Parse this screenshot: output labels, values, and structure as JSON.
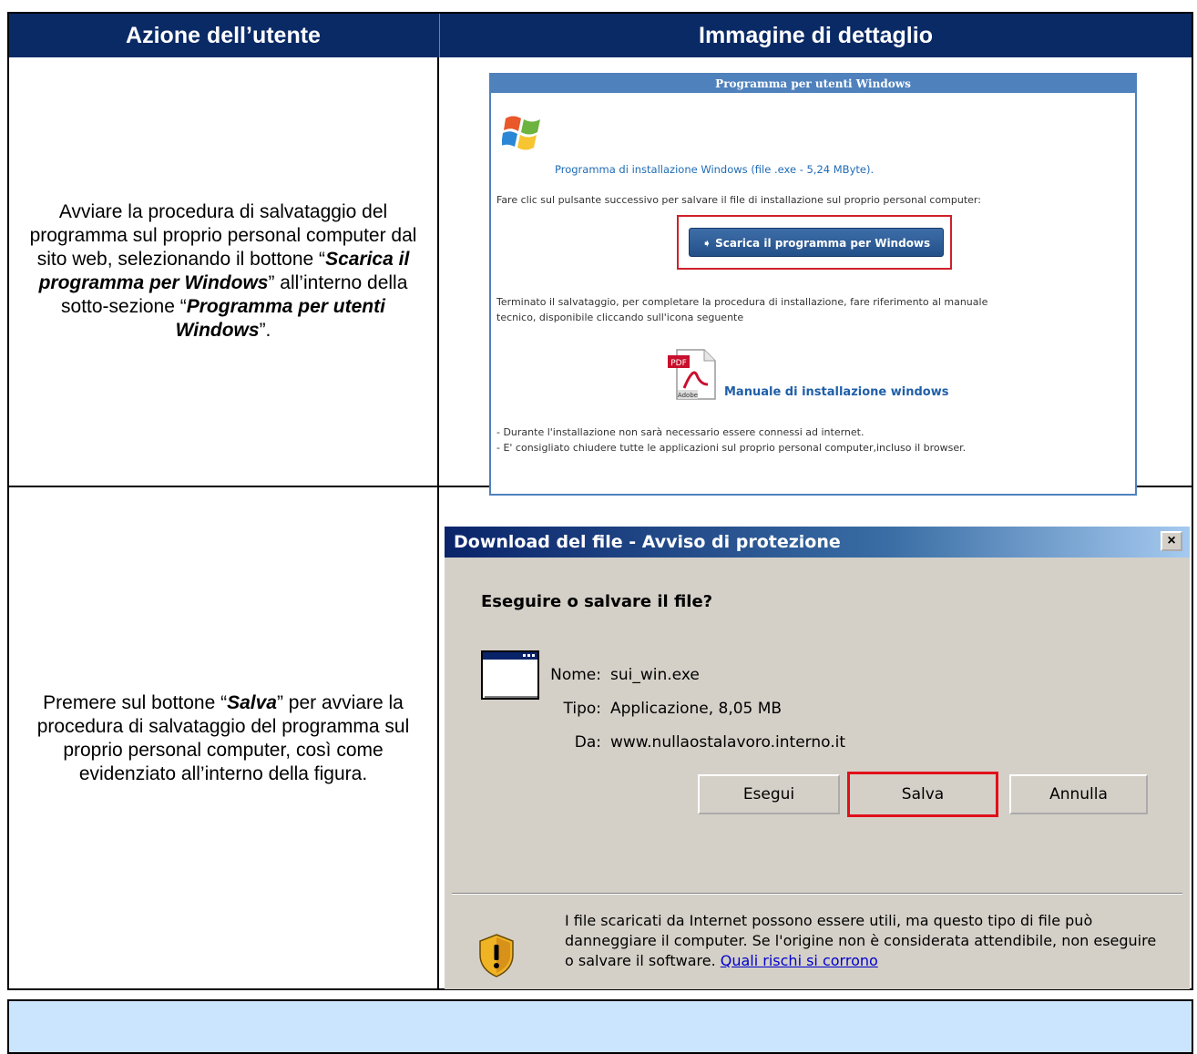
{
  "header": {
    "col1": "Azione dell’utente",
    "col2": "Immagine di dettaglio"
  },
  "row1": {
    "instruction_pre": "Avviare la procedura di salvataggio del programma sul proprio personal computer dal sito web, selezionando il bottone “",
    "instruction_bold1": "Scarica il programma per Windows",
    "instruction_mid": "” all’interno della sotto-sezione “",
    "instruction_bold2": "Programma per utenti Windows",
    "instruction_post": "”."
  },
  "webpanel": {
    "title": "Programma per utenti Windows",
    "installer_label": "Programma di installazione Windows (file .exe - 5,24 MByte).",
    "click_text": "Fare clic sul pulsante successivo per salvare il file di installazione sul proprio personal computer:",
    "download_button": "Scarica il programma per Windows",
    "after_text_1": "Terminato il salvataggio, per completare la procedura di installazione, fare riferimento al manuale",
    "after_text_2": "tecnico, disponibile cliccando sull'icona seguente",
    "pdf_badge": "PDF",
    "pdf_brand": "Adobe",
    "manual_link": "Manuale di installazione windows",
    "note_1": "- Durante l'installazione non sarà necessario essere connessi ad internet.",
    "note_2": "- E' consigliato chiudere tutte le applicazioni sul proprio personal computer,incluso il browser."
  },
  "row2": {
    "instruction_pre": "Premere sul bottone “",
    "instruction_bold": "Salva",
    "instruction_post": "” per avviare la procedura di salvataggio del programma sul proprio personal computer, così come evidenziato all’interno della figura."
  },
  "dialog": {
    "title": "Download del file - Avviso di protezione",
    "close_glyph": "×",
    "question": "Eseguire o salvare il file?",
    "name_label": "Nome:",
    "name_value": "sui_win.exe",
    "type_label": "Tipo:",
    "type_value": "Applicazione, 8,05 MB",
    "from_label": "Da:",
    "from_value": "www.nullaostalavoro.interno.it",
    "buttons": [
      "Esegui",
      "Salva",
      "Annulla"
    ],
    "warning_text": "I file scaricati da Internet possono essere utili, ma questo tipo di file può danneggiare il computer. Se l'origine non è considerata attendibile, non eseguire o salvare il software. ",
    "risk_link": "Quali rischi si corrono"
  }
}
